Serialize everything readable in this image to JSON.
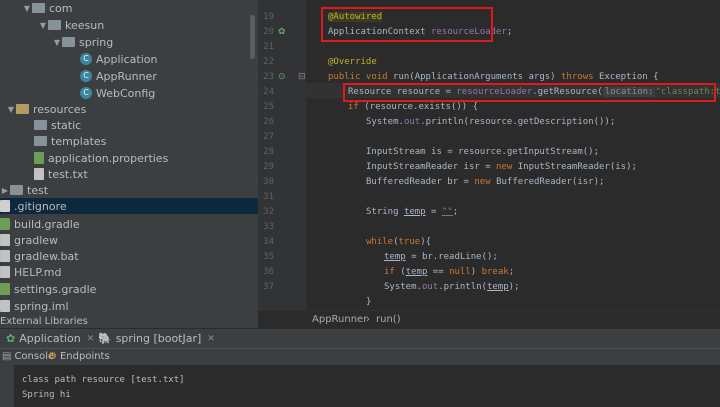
{
  "project_tree": [
    {
      "label": "com",
      "type": "folder",
      "expanded": true
    },
    {
      "label": "keesun",
      "type": "folder",
      "expanded": true
    },
    {
      "label": "spring",
      "type": "folder",
      "expanded": true
    },
    {
      "label": "Application",
      "type": "class"
    },
    {
      "label": "AppRunner",
      "type": "class"
    },
    {
      "label": "WebConfig",
      "type": "class"
    },
    {
      "label": "resources",
      "type": "resource-folder",
      "expanded": true
    },
    {
      "label": "static",
      "type": "folder"
    },
    {
      "label": "templates",
      "type": "folder"
    },
    {
      "label": "application.properties",
      "type": "properties"
    },
    {
      "label": "test.txt",
      "type": "file"
    },
    {
      "label": "test",
      "type": "folder",
      "expanded": false
    },
    {
      "label": ".gitignore",
      "type": "file",
      "selected": true
    },
    {
      "label": "build.gradle",
      "type": "file"
    },
    {
      "label": "gradlew",
      "type": "file"
    },
    {
      "label": "gradlew.bat",
      "type": "file"
    },
    {
      "label": "HELP.md",
      "type": "file"
    },
    {
      "label": "settings.gradle",
      "type": "file"
    },
    {
      "label": "spring.iml",
      "type": "file"
    }
  ],
  "external_libraries": "External Libraries",
  "line_numbers": [
    "19",
    "20",
    "21",
    "22",
    "23",
    "24",
    "25",
    "26",
    "27",
    "28",
    "29",
    "30",
    "31",
    "32",
    "33",
    "34",
    "35",
    "36",
    "37"
  ],
  "code": {
    "l19_annotation": "@Autowired",
    "l20_type": "ApplicationContext ",
    "l20_field": "resourceLoader",
    "l20_end": ";",
    "l22_annotation": "@Override",
    "l23_public": "public void ",
    "l23_sig": "run(ApplicationArguments args) ",
    "l23_throws": "throws ",
    "l23_exc": "Exception {",
    "l24_start": "Resource resource = ",
    "l24_field": "resourceLoader",
    "l24_call": ".getResource(",
    "l24_hint": "location:",
    "l24_str": "\"classpath:test.txt\"",
    "l24_end": ");",
    "l25_if": "if ",
    "l25_rest": "(resource.exists()) {",
    "l26_a": "System.",
    "l26_out": "out",
    "l26_b": ".println(resource.getDescription());",
    "l28": "InputStream is = resource.getInputStream();",
    "l29_a": "InputStreamReader isr = ",
    "l29_new": "new ",
    "l29_b": "InputStreamReader(is);",
    "l30_a": "BufferedReader br = ",
    "l30_new": "new ",
    "l30_b": "BufferedReader(isr);",
    "l32_a": "String ",
    "l32_var": "temp",
    "l32_b": " = ",
    "l32_str": "\"\"",
    "l32_end": ";",
    "l34_while": "while",
    "l34_paren": "(",
    "l34_true": "true",
    "l34_end": "){",
    "l35_var": "temp",
    "l35_rest": " = br.readLine();",
    "l36_if": "if ",
    "l36_paren": "(",
    "l36_var": "temp",
    "l36_eq": " == ",
    "l36_null": "null",
    "l36_close": ") ",
    "l36_break": "break",
    "l36_end": ";",
    "l37_a": "System.",
    "l37_out": "out",
    "l37_b": ".println(",
    "l37_var": "temp",
    "l37_end": ");",
    "l38": "}"
  },
  "breadcrumb": {
    "class": "AppRunner",
    "sep": "›",
    "method": "run()"
  },
  "run_tabs": [
    {
      "label": "Application",
      "active": true
    },
    {
      "label": "spring [bootJar]",
      "active": false
    }
  ],
  "console_tabs": [
    {
      "label": "Console"
    },
    {
      "label": "Endpoints"
    }
  ],
  "console_output": [
    "class path resource [test.txt]",
    "Spring hi"
  ],
  "colors": {
    "highlight_box": "#e01a1a",
    "keyword": "#cc7832",
    "annotation": "#bbb529",
    "string": "#6a8759",
    "field": "#9876aa"
  }
}
